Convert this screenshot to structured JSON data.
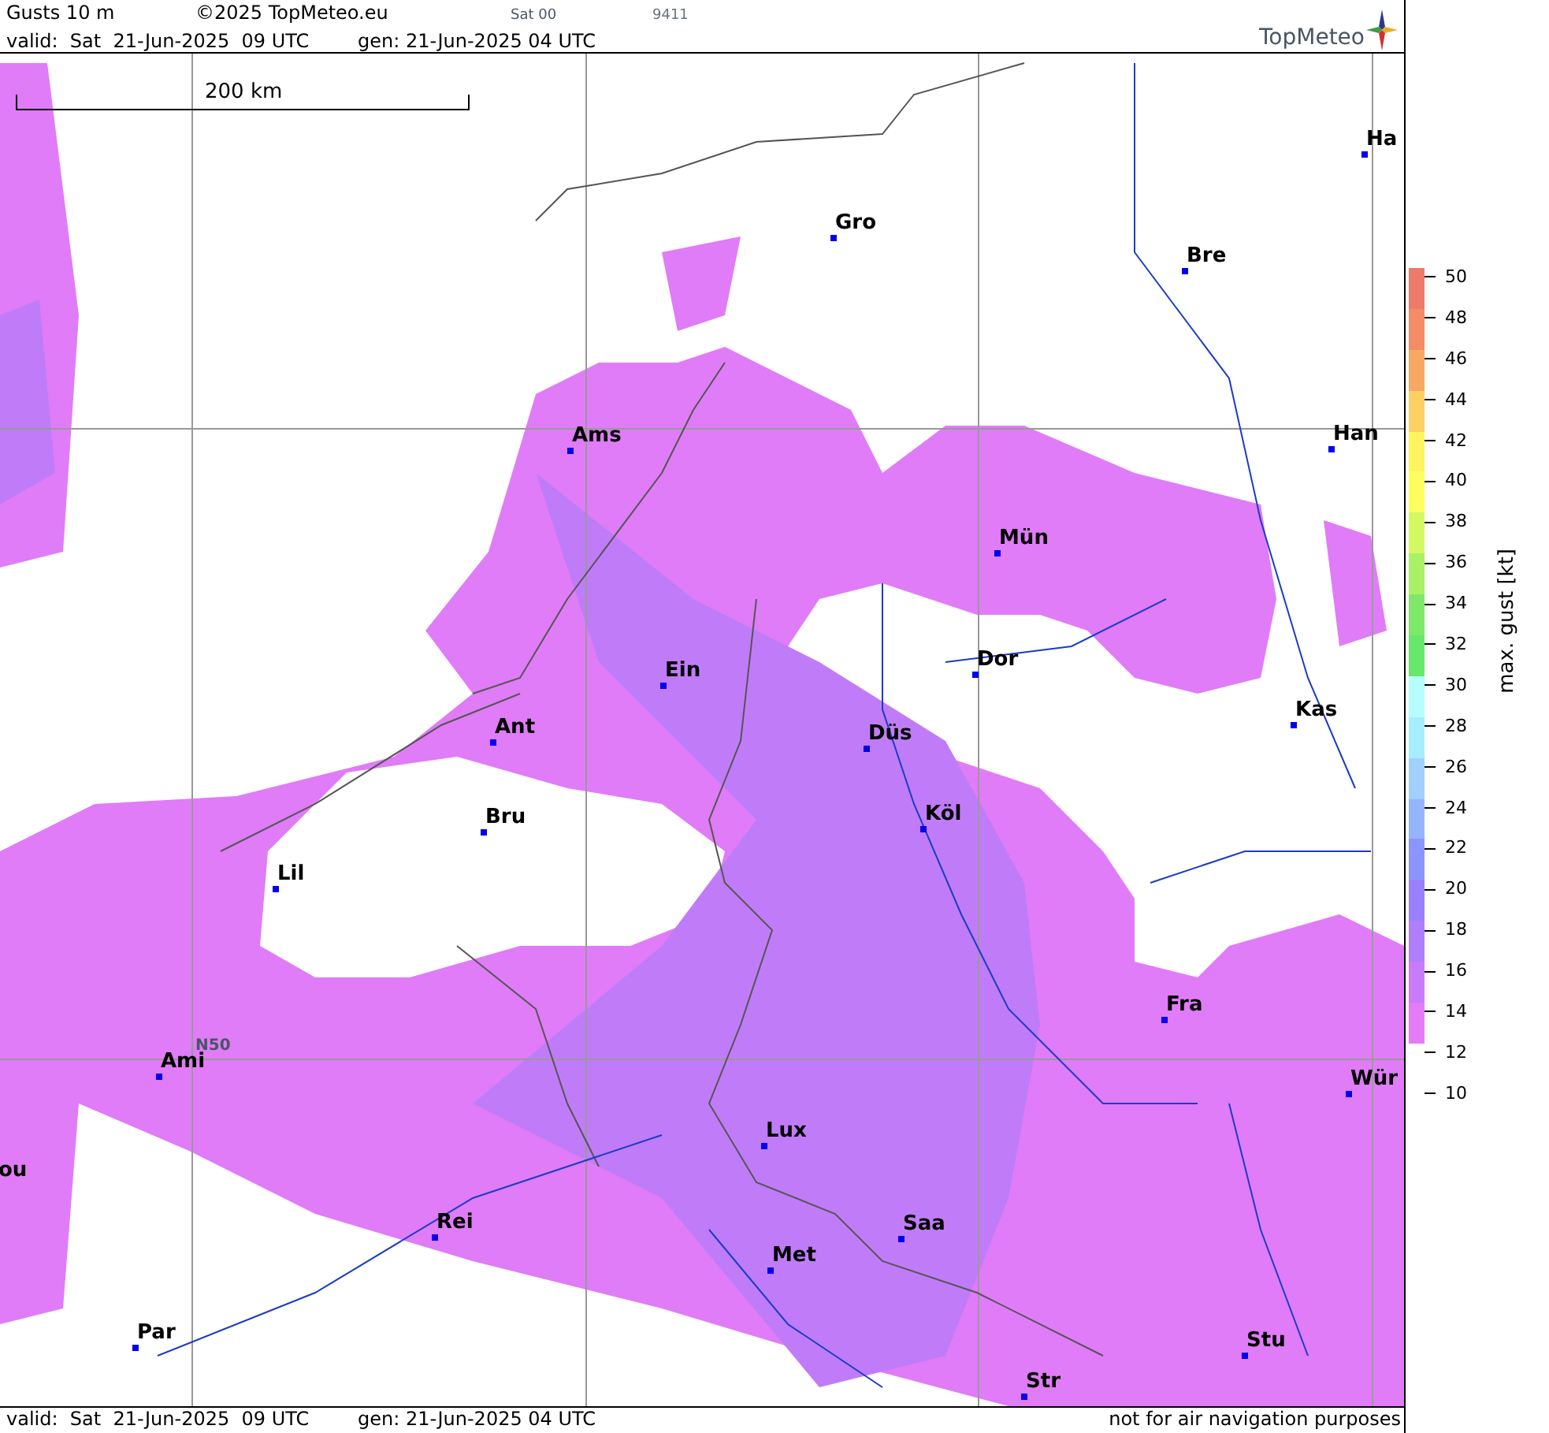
{
  "header": {
    "title": "Gusts 10 m",
    "copyright": "©2025 TopMeteo.eu",
    "run": "Sat 00",
    "code": "9411",
    "valid": "valid:  Sat  21-Jun-2025  09 UTC",
    "generated": "gen: 21-Jun-2025 04 UTC",
    "logo": "TopMeteo"
  },
  "map": {
    "scale_label": "200 km",
    "grid_label": "N50",
    "cities": [
      {
        "name": "Ha"
      },
      {
        "name": "Gro"
      },
      {
        "name": "Bre"
      },
      {
        "name": "Ams"
      },
      {
        "name": "Han"
      },
      {
        "name": "Mün"
      },
      {
        "name": "Dor"
      },
      {
        "name": "Ein"
      },
      {
        "name": "Kas"
      },
      {
        "name": "Düs"
      },
      {
        "name": "Ant"
      },
      {
        "name": "Köl"
      },
      {
        "name": "Bru"
      },
      {
        "name": "Lil"
      },
      {
        "name": "Fra"
      },
      {
        "name": "Ami"
      },
      {
        "name": "Wür"
      },
      {
        "name": "Lux"
      },
      {
        "name": "ou"
      },
      {
        "name": "Rei"
      },
      {
        "name": "Saa"
      },
      {
        "name": "Met"
      },
      {
        "name": "Par"
      },
      {
        "name": "Stu"
      },
      {
        "name": "Str"
      }
    ]
  },
  "legend": {
    "title": "max. gust [kt]",
    "ticks": [
      "50",
      "48",
      "46",
      "44",
      "42",
      "40",
      "38",
      "36",
      "34",
      "32",
      "30",
      "28",
      "26",
      "24",
      "22",
      "20",
      "18",
      "16",
      "14",
      "12",
      "10"
    ],
    "bands": [
      {
        "color": "#ee7a6a"
      },
      {
        "color": "#f48c66"
      },
      {
        "color": "#f8a862"
      },
      {
        "color": "#fcd062"
      },
      {
        "color": "#fdf45e"
      },
      {
        "color": "#fefe5e"
      },
      {
        "color": "#d4f862"
      },
      {
        "color": "#a8f266"
      },
      {
        "color": "#7ee868"
      },
      {
        "color": "#66e86a"
      },
      {
        "color": "#b6fefe"
      },
      {
        "color": "#a6eefe"
      },
      {
        "color": "#a2d0fe"
      },
      {
        "color": "#94b4fe"
      },
      {
        "color": "#8a96fe"
      },
      {
        "color": "#9a80fe"
      },
      {
        "color": "#ae7efc"
      },
      {
        "color": "#c87cfa"
      },
      {
        "color": "#e47cf8"
      }
    ]
  },
  "footer": {
    "valid": "valid:  Sat  21-Jun-2025  09 UTC",
    "generated": "gen: 21-Jun-2025 04 UTC",
    "disclaimer": "not for air navigation purposes"
  }
}
